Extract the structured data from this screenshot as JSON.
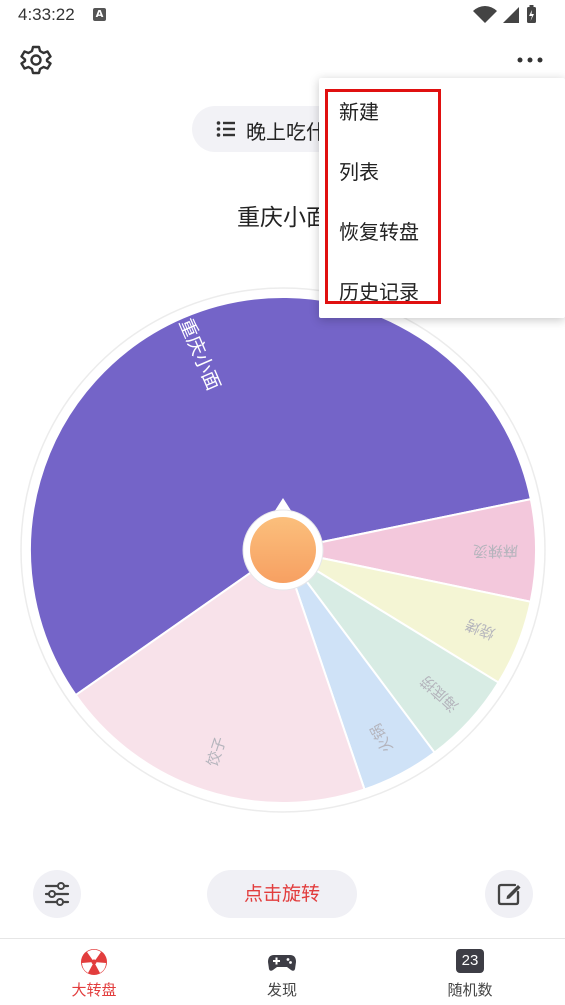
{
  "status_bar": {
    "time": "4:33:22",
    "notification_icon": "A"
  },
  "header": {
    "title": "晚上吃什么",
    "settings_icon": "gear-icon",
    "more_icon": "more-dots-icon"
  },
  "result_text": "重庆小面",
  "wheel": {
    "segments": [
      {
        "label": "重庆小面",
        "color": "#7464c8",
        "share": 0.565
      },
      {
        "label": "麻辣烫",
        "color": "#f3c8dc",
        "share": 0.065
      },
      {
        "label": "烧烤",
        "color": "#f4f5d4",
        "share": 0.055
      },
      {
        "label": "海底捞",
        "color": "#d8ece4",
        "share": 0.06
      },
      {
        "label": "火锅",
        "color": "#cfe2f7",
        "share": 0.05
      },
      {
        "label": "饺子",
        "color": "#f8e2ea",
        "share": 0.205
      }
    ],
    "center_color": "#f7a062"
  },
  "actions": {
    "spin_label": "点击旋转",
    "left_icon": "sliders-icon",
    "right_icon": "edit-icon"
  },
  "tabs": [
    {
      "label": "大转盘",
      "icon": "wheel-icon",
      "active": true
    },
    {
      "label": "发现",
      "icon": "gamepad-icon",
      "active": false
    },
    {
      "label": "随机数",
      "icon": "number-23-icon",
      "badge": "23",
      "active": false
    }
  ],
  "menu": {
    "items": [
      "新建",
      "列表",
      "恢复转盘",
      "历史记录"
    ]
  },
  "colors": {
    "accent": "#e23d3d",
    "wheel_primary": "#7464c8",
    "annotation": "#e01010"
  }
}
